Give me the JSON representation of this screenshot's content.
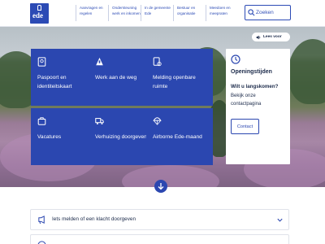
{
  "header": {
    "logo_text": "ede",
    "nav": [
      {
        "label": "Aanvragen en regelen"
      },
      {
        "label": "Ondersteuning werk en inkomen"
      },
      {
        "label": "In de gemeente Ede"
      },
      {
        "label": "Bestuur en organisatie"
      },
      {
        "label": "Meedoen en meepraten"
      }
    ],
    "search_placeholder": "Zoeken"
  },
  "hero": {
    "leesvoor_label": "Lees voor",
    "tiles": [
      {
        "label": "Paspoort en identiteitskaart",
        "icon": "passport-icon"
      },
      {
        "label": "Werk aan de weg",
        "icon": "roadwork-icon"
      },
      {
        "label": "Melding openbare ruimte",
        "icon": "report-icon"
      },
      {
        "label": "Vacatures",
        "icon": "briefcase-icon"
      },
      {
        "label": "Verhuizing doorgeven",
        "icon": "moving-truck-icon"
      },
      {
        "label": "Airborne Ede-maand",
        "icon": "parachute-icon"
      }
    ],
    "opening": {
      "title": "Openingstijden",
      "subtitle": "Wilt u langskomen?",
      "body": "Bekijk onze contactpagina",
      "button": "Contact"
    }
  },
  "accordion": [
    {
      "label": "Iets melden of een klacht doorgeven"
    },
    {
      "label": ""
    }
  ],
  "colors": {
    "brand_blue": "#2b47b0",
    "white": "#ffffff"
  }
}
